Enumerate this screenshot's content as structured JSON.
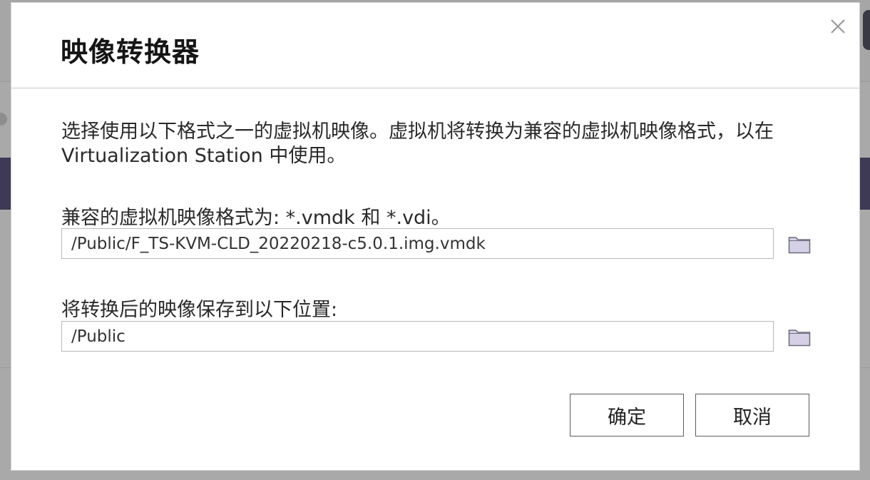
{
  "dialog": {
    "title": "映像转换器",
    "description": "选择使用以下格式之一的虚拟机映像。虚拟机将转换为兼容的虚拟机映像格式，以在 Virtualization Station 中使用。",
    "source_label": "兼容的虚拟机映像格式为: *.vmdk 和 *.vdi。",
    "source_value": "/Public/F_TS-KVM-CLD_20220218-c5.0.1.img.vmdk",
    "dest_label": "将转换后的映像保存到以下位置:",
    "dest_value": "/Public",
    "ok_label": "确定",
    "cancel_label": "取消"
  },
  "icons": {
    "close": "close-icon",
    "folder": "folder-icon"
  },
  "colors": {
    "folder_fill": "#d6d0e6",
    "folder_stroke": "#6b6b7a",
    "backdrop_band": "#3e3a55"
  }
}
